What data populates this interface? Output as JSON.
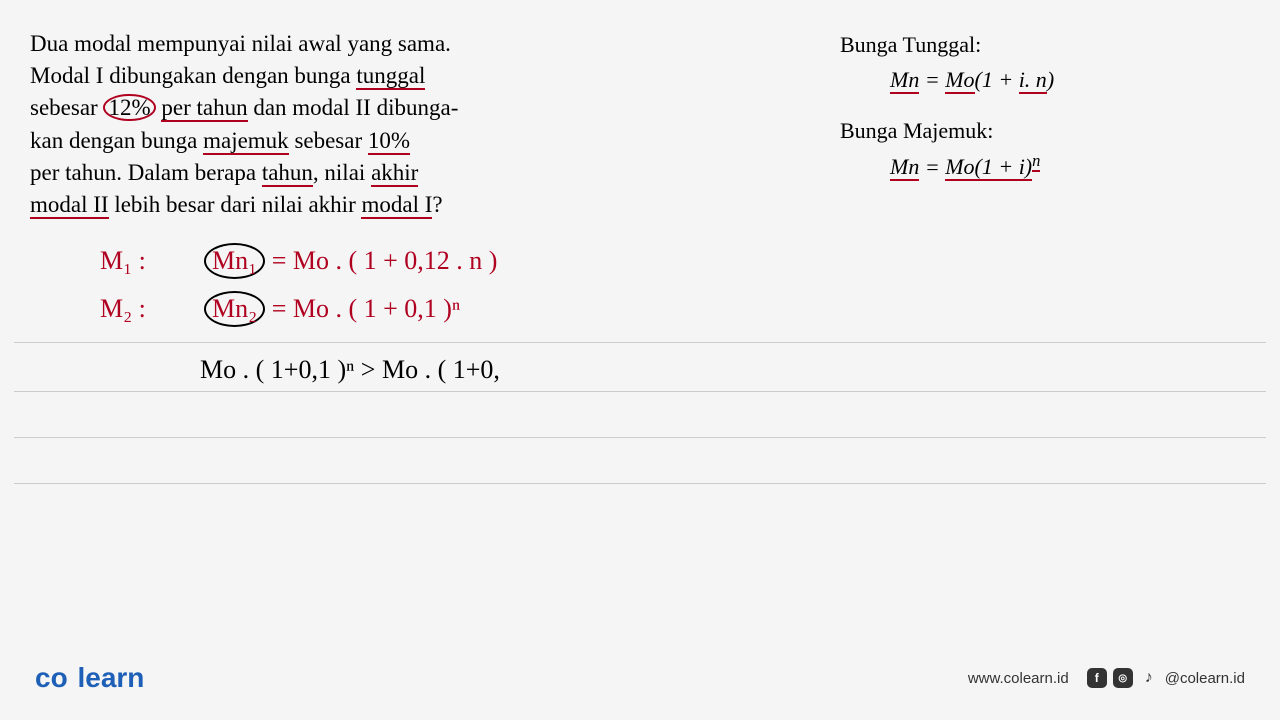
{
  "question": {
    "line1_a": "Dua modal mempunyai nilai awal yang sama.",
    "line2_a": "Modal I dibungakan dengan bunga",
    "line2_b": "tunggal",
    "line3_a": "sebesar",
    "line3_b": "12%",
    "line3_c": "per tahun",
    "line3_d": "dan modal II dibunga-",
    "line4_a": "kan dengan bunga",
    "line4_b": "majemuk",
    "line4_c": "sebesar",
    "line4_d": "10%",
    "line5_a": "per tahun",
    "line5_b": ". Dalam berapa",
    "line5_c": "tahun",
    "line5_d": ", nilai",
    "line5_e": "akhir",
    "line6_a": "modal II",
    "line6_b": "lebih besar dari nilai akhir",
    "line6_c": "modal I",
    "line6_d": "?"
  },
  "formulas": {
    "t1": "Bunga Tunggal:",
    "f1_mn": "Mn",
    "f1_eq": " = ",
    "f1_mo": "Mo",
    "f1_a": "(1 + ",
    "f1_b": "i. n",
    "f1_c": ")",
    "t2": "Bunga Majemuk:",
    "f2_mn": "Mn",
    "f2_mo": "Mo",
    "f2_a": "(1 + i)",
    "f2_n": "n"
  },
  "handwritten": {
    "m1_label": "M₁ :",
    "m1_var": "Mn₁",
    "m1_eq": "= Mo . ( 1 + 0,12 . n )",
    "m2_label": "M₂ :",
    "m2_var": "Mn₂",
    "m2_eq": "= Mo . ( 1 + 0,1 )ⁿ",
    "ineq": "Mo . ( 1+0,1 )ⁿ  >  Mo . ( 1+0,"
  },
  "footer": {
    "logo_a": "co",
    "logo_b": "learn",
    "url": "www.colearn.id",
    "handle": "@colearn.id"
  }
}
